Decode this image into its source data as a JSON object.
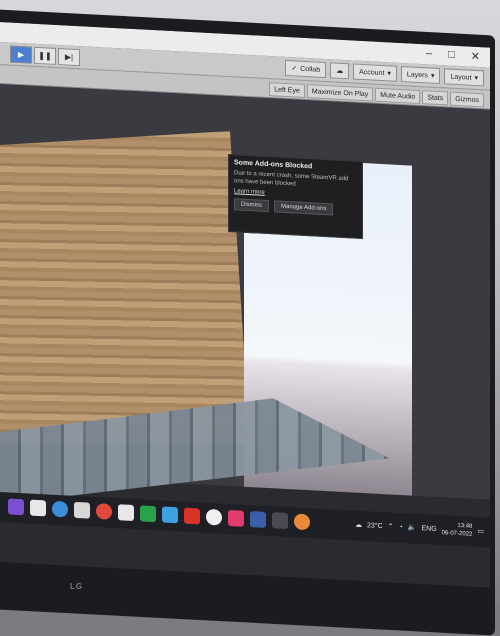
{
  "toolbar": {
    "play_icon": "play-icon",
    "pause_icon": "pause-icon",
    "step_icon": "step-icon",
    "collab_label": "Collab",
    "account_label": "Account",
    "layers_label": "Layers",
    "layout_label": "Layout"
  },
  "game_bar": {
    "eye_label": "Left Eye",
    "maximize_label": "Maximize On Play",
    "mute_label": "Mute Audio",
    "stats_label": "Stats",
    "gizmos_label": "Gizmos"
  },
  "notification": {
    "title": "Some Add-ons Blocked",
    "message": "Due to a recent crash, some SteamVR add ons have been blocked",
    "link": "Learn more",
    "dismiss_label": "Dismiss",
    "manage_label": "Manage Add-ons"
  },
  "taskbar": {
    "temperature": "23°C",
    "language": "ENG",
    "time": "13:48",
    "date": "06-07-2022"
  },
  "monitor": {
    "brand": "LG"
  },
  "colors": {
    "play_accent": "#4b7fd1",
    "notification_bg": "#1f1f22",
    "taskbar_bg": "#1f1f26"
  }
}
